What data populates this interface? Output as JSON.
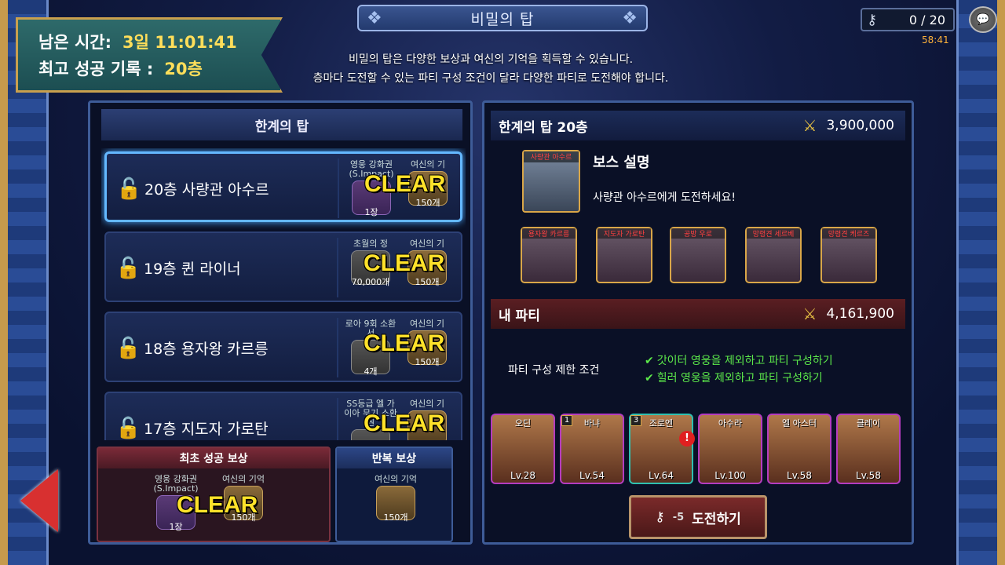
{
  "header": {
    "title": "비밀의 탑"
  },
  "timer": {
    "remaining_label": "남은 시간:",
    "remaining_value": "3일 11:01:41",
    "best_label": "최고 성공 기록 :",
    "best_value": "20층"
  },
  "description": {
    "line1": "비밀의 탑은 다양한 보상과 여신의 기억을 획득할 수 있습니다.",
    "line2": "층마다 도전할 수 있는 파티 구성 조건이 달라 다양한 파티로 도전해야 합니다."
  },
  "keys": {
    "count": "0 / 20",
    "timer": "58:41"
  },
  "left": {
    "title": "한계의 탑",
    "floors": [
      {
        "name": "20층 사량관 아수르",
        "r1_name": "영웅 강화권 (S.Impact)",
        "r1_count": "1장",
        "r2_name": "여신의 기",
        "r2_count": "150개",
        "status": "CLEAR"
      },
      {
        "name": "19층 퀸 라이너",
        "r1_name": "초월의 정",
        "r1_count": "70,000개",
        "r2_name": "여신의 기",
        "r2_count": "150개",
        "status": "CLEAR"
      },
      {
        "name": "18층 용자왕 카르릉",
        "r1_name": "로아 9회 소환서",
        "r1_count": "4개",
        "r2_name": "여신의 기",
        "r2_count": "150개",
        "status": "CLEAR"
      },
      {
        "name": "17층 지도자 가로탄",
        "r1_name": "SS등급 엘 가이아 무기 소환권",
        "r1_count": "",
        "r2_name": "여신의 기",
        "r2_count": "",
        "status": "CLEAR"
      }
    ],
    "first_reward": {
      "title": "최초 성공 보상",
      "r1_name": "영웅 강화권 (S.Impact)",
      "r1_count": "1장",
      "r2_name": "여신의 기억",
      "r2_count": "150개",
      "status": "CLEAR"
    },
    "repeat_reward": {
      "title": "반복 보상",
      "r_name": "여신의 기억",
      "r_count": "150개"
    }
  },
  "right": {
    "floor_title": "한계의 탑 20층",
    "boss_power": "3,900,000",
    "boss": {
      "tag": "사량관 아수르",
      "title": "보스 설명",
      "desc": "사량관 아수르에게 도전하세요!"
    },
    "minions": [
      "용자왕 카르릉",
      "지도자 가로탄",
      "공방 우로",
      "망령견 세르베",
      "망령견 케르즈"
    ],
    "party_title": "내 파티",
    "party_power": "4,161,900",
    "condition_label": "파티 구성 제한 조건",
    "conditions": [
      "갓이터 영웅을 제외하고 파티 구성하기",
      "힐러 영웅을 제외하고 파티 구성하기"
    ],
    "heroes": [
      {
        "name": "오딘",
        "lv": "Lv.28",
        "badge": ""
      },
      {
        "name": "바냐",
        "lv": "Lv.54",
        "badge": "1"
      },
      {
        "name": "조로엔",
        "lv": "Lv.64",
        "badge": "3"
      },
      {
        "name": "아수라",
        "lv": "Lv.100",
        "badge": ""
      },
      {
        "name": "엘 아스터",
        "lv": "Lv.58",
        "badge": ""
      },
      {
        "name": "클레이",
        "lv": "Lv.58",
        "badge": ""
      }
    ],
    "challenge": {
      "cost": "-5",
      "label": "도전하기"
    }
  },
  "colors": {
    "clear": "#ffe22a",
    "condition": "#5ce84a",
    "accent": "#64b8ff"
  }
}
